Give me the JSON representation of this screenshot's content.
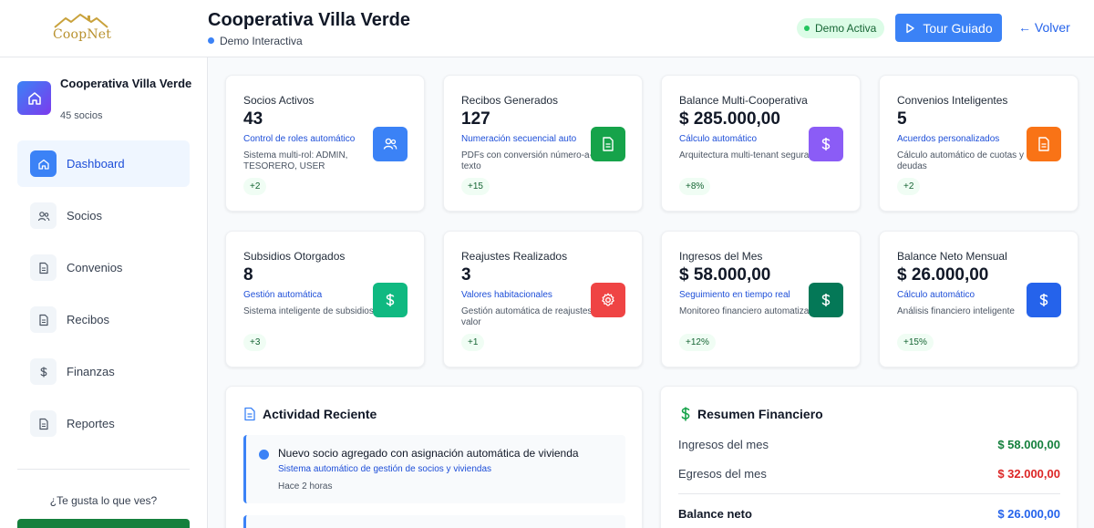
{
  "header": {
    "logo_text": "CoopNet",
    "title": "Cooperativa Villa Verde",
    "subtitle": "Demo Interactiva",
    "badge": "Demo Activa",
    "tour_button": "Tour Guiado",
    "back_link": "← Volver"
  },
  "sidebar": {
    "coop_name": "Cooperativa Villa Verde",
    "coop_members": "45 socios",
    "items": [
      {
        "label": "Dashboard",
        "icon": "home-icon",
        "active": true
      },
      {
        "label": "Socios",
        "icon": "users-icon",
        "active": false
      },
      {
        "label": "Convenios",
        "icon": "document-icon",
        "active": false
      },
      {
        "label": "Recibos",
        "icon": "document-icon",
        "active": false
      },
      {
        "label": "Finanzas",
        "icon": "dollar-icon",
        "active": false
      },
      {
        "label": "Reportes",
        "icon": "document-icon",
        "active": false
      }
    ],
    "footer_question": "¿Te gusta lo que ves?"
  },
  "cards": [
    {
      "label": "Socios Activos",
      "value": "43",
      "sub": "Control de roles automático",
      "desc": "Sistema multi-rol: ADMIN, TESORERO, USER",
      "chip": "+2",
      "icon": "users-icon",
      "color": "#3b82f6"
    },
    {
      "label": "Recibos Generados",
      "value": "127",
      "sub": "Numeración secuencial auto",
      "desc": "PDFs con conversión número-a-texto",
      "chip": "+15",
      "icon": "document-icon",
      "color": "#16a34a"
    },
    {
      "label": "Balance Multi-Cooperativa",
      "value": "$ 285.000,00",
      "sub": "Cálculo automático",
      "desc": "Arquitectura multi-tenant segura",
      "chip": "+8%",
      "icon": "dollar-icon",
      "color": "#8b5cf6"
    },
    {
      "label": "Convenios Inteligentes",
      "value": "5",
      "sub": "Acuerdos personalizados",
      "desc": "Cálculo automático de cuotas y deudas",
      "chip": "+2",
      "icon": "document-icon",
      "color": "#f97316"
    },
    {
      "label": "Subsidios Otorgados",
      "value": "8",
      "sub": "Gestión automática",
      "desc": "Sistema inteligente de subsidios",
      "chip": "+3",
      "icon": "dollar-icon",
      "color": "#10b981"
    },
    {
      "label": "Reajustes Realizados",
      "value": "3",
      "sub": "Valores habitacionales",
      "desc": "Gestión automática de reajustes de valor",
      "chip": "+1",
      "icon": "gear-icon",
      "color": "#ef4444"
    },
    {
      "label": "Ingresos del Mes",
      "value": "$ 58.000,00",
      "sub": "Seguimiento en tiempo real",
      "desc": "Monitoreo financiero automatizado",
      "chip": "+12%",
      "icon": "dollar-icon",
      "color": "#047857"
    },
    {
      "label": "Balance Neto Mensual",
      "value": "$ 26.000,00",
      "sub": "Cálculo automático",
      "desc": "Análisis financiero inteligente",
      "chip": "+15%",
      "icon": "dollar-icon",
      "color": "#2563eb"
    }
  ],
  "activity": {
    "title": "Actividad Reciente",
    "items": [
      {
        "title": "Nuevo socio agregado con asignación automática de vivienda",
        "sub": "Sistema automático de gestión de socios y viviendas",
        "time": "Hace 2 horas"
      }
    ]
  },
  "finance": {
    "title": "Resumen Financiero",
    "rows": [
      {
        "label": "Ingresos del mes",
        "amount": "$ 58.000,00",
        "color": "#15803d"
      },
      {
        "label": "Egresos del mes",
        "amount": "$ 32.000,00",
        "color": "#dc2626"
      },
      {
        "label": "Balance neto",
        "amount": "$ 26.000,00",
        "color": "#2563eb"
      }
    ]
  }
}
